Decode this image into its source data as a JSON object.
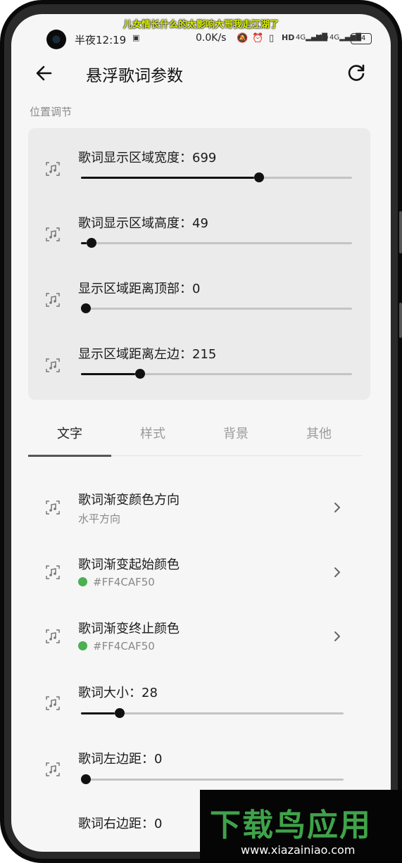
{
  "floating_lyric": "儿女情长什么的太影响大哥我走江湖了",
  "status": {
    "time": "半夜12:19",
    "net_speed": "0.0K/s",
    "hd1": "HD",
    "hd2": "HD",
    "signal1": "4G",
    "signal2": "4G",
    "battery": "64"
  },
  "header": {
    "title": "悬浮歌词参数"
  },
  "position_section": {
    "label": "位置调节",
    "sliders": [
      {
        "label": "歌词显示区域宽度：699",
        "value": 699,
        "fraction": 0.64
      },
      {
        "label": "歌词显示区域高度：49",
        "value": 49,
        "fraction": 0.02
      },
      {
        "label": "显示区域距离顶部：0",
        "value": 0,
        "fraction": 0.0
      },
      {
        "label": "显示区域距离左边：215",
        "value": 215,
        "fraction": 0.2
      }
    ]
  },
  "tabs": [
    "文字",
    "样式",
    "背景",
    "其他"
  ],
  "active_tab": 0,
  "text_settings": {
    "gradient_direction": {
      "label": "歌词渐变颜色方向",
      "value": "水平方向"
    },
    "gradient_start": {
      "label": "歌词渐变起始颜色",
      "value": "#FF4CAF50",
      "swatch": "#4CAF50"
    },
    "gradient_end": {
      "label": "歌词渐变终止颜色",
      "value": "#FF4CAF50",
      "swatch": "#4CAF50"
    },
    "size_slider": {
      "label": "歌词大小：28",
      "value": 28,
      "fraction": 0.13
    },
    "left_margin_slider": {
      "label": "歌词左边距：0",
      "value": 0,
      "fraction": 0.0
    },
    "right_margin_partial": "歌词右边距：0"
  },
  "watermark": {
    "logo": "下载鸟应用",
    "url": "www.xiazainiao.com"
  }
}
